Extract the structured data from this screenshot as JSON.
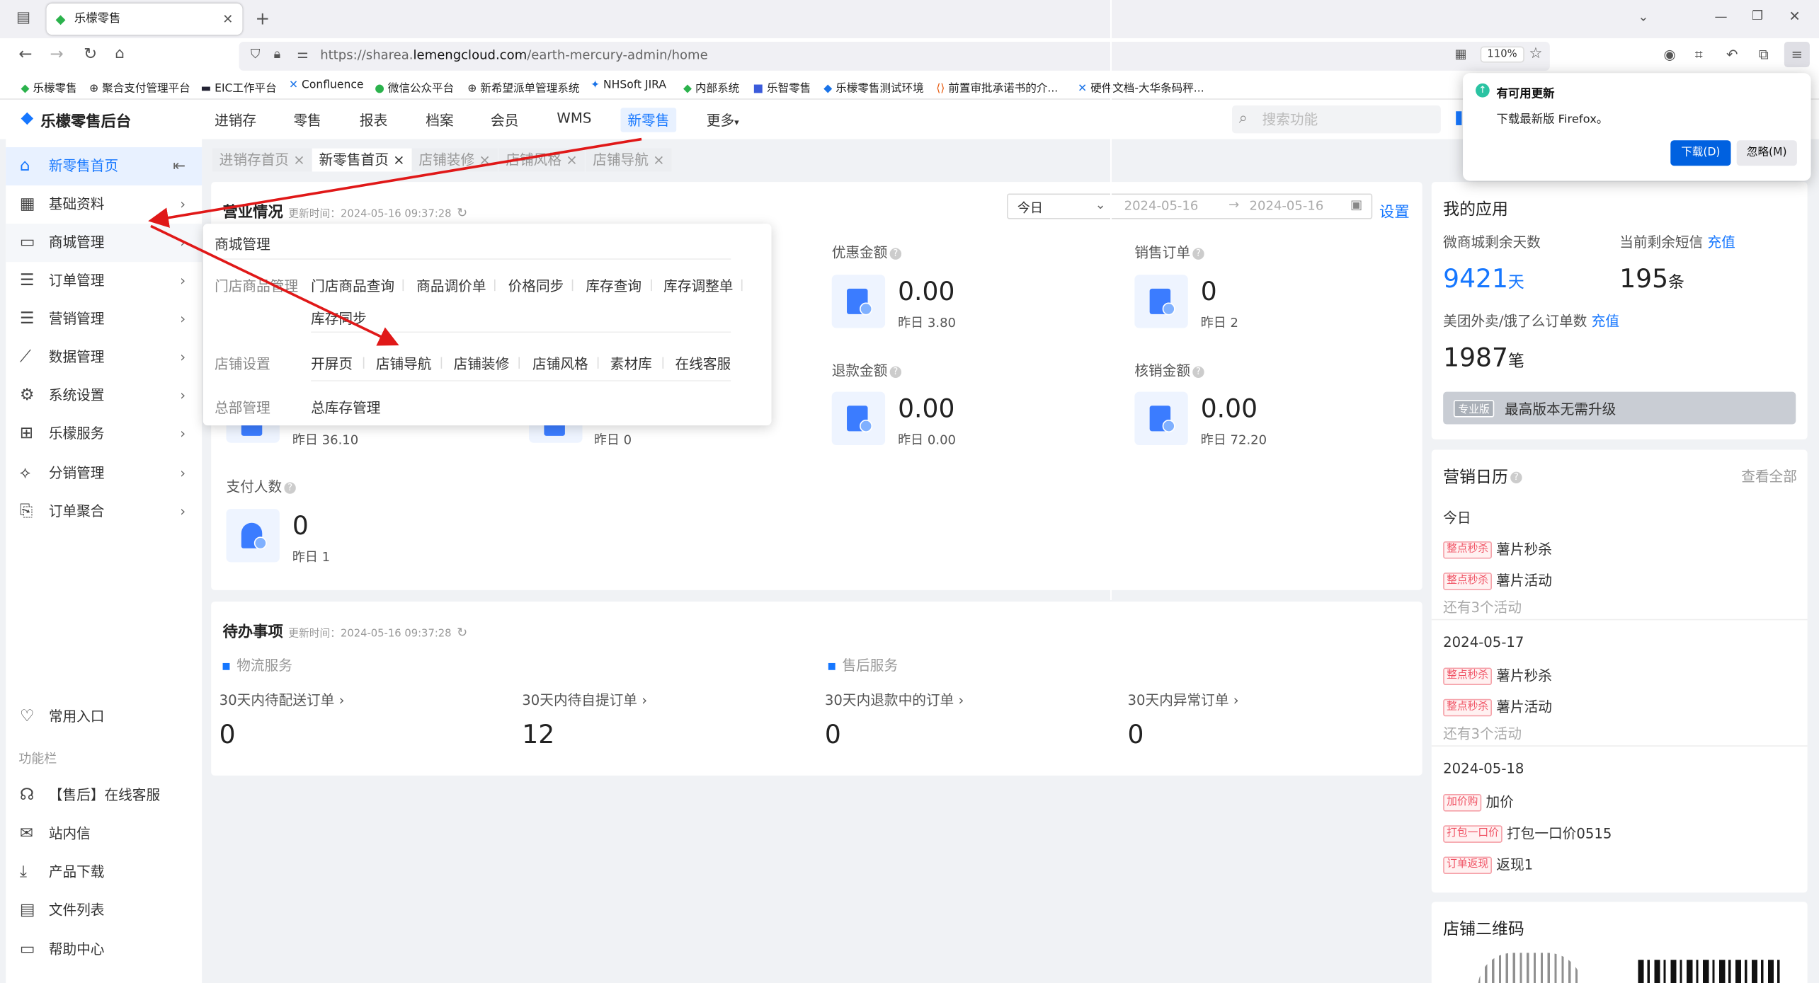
{
  "browser": {
    "tab_title": "乐檬零售",
    "url_prefix": "https://sharea.",
    "url_domain": "lemengcloud.com",
    "url_path": "/earth-mercury-admin/home",
    "zoom": "110%",
    "bookmarks": [
      "乐檬零售",
      "聚合支付管理平台",
      "EIC工作平台",
      "Confluence",
      "微信公众平台",
      "新希望派单管理系统",
      "NHSoft JIRA",
      "内部系统",
      "乐智零售",
      "乐檬零售测试环境",
      "前置审批承诺书的介...",
      "硬件文档-大华条码秤..."
    ]
  },
  "app": {
    "logo": "乐檬零售后台",
    "nav": [
      "进销存",
      "零售",
      "报表",
      "档案",
      "会员",
      "WMS",
      "新零售",
      "更多"
    ],
    "search_placeholder": "搜索功能"
  },
  "sidebar": {
    "items": [
      {
        "label": "新零售首页",
        "icon": "home-icon"
      },
      {
        "label": "基础资料",
        "icon": "grid-icon"
      },
      {
        "label": "商城管理",
        "icon": "shop-icon"
      },
      {
        "label": "订单管理",
        "icon": "list-icon"
      },
      {
        "label": "营销管理",
        "icon": "list-icon"
      },
      {
        "label": "数据管理",
        "icon": "chart-line-icon"
      },
      {
        "label": "系统设置",
        "icon": "gear-icon"
      },
      {
        "label": "乐檬服务",
        "icon": "briefcase-icon"
      },
      {
        "label": "分销管理",
        "icon": "share-icon"
      },
      {
        "label": "订单聚合",
        "icon": "doc-icon"
      }
    ],
    "common_entry": "常用入口",
    "func_bar": "功能栏",
    "func_items": [
      "【售后】在线客服",
      "站内信",
      "产品下载",
      "文件列表",
      "帮助中心"
    ]
  },
  "page_tabs": [
    "进销存首页",
    "新零售首页",
    "店铺装修",
    "店铺风格",
    "店铺导航"
  ],
  "business": {
    "title": "营业情况",
    "update_time": "更新时间：2024-05-16 09:37:28",
    "period": "今日",
    "date_from": "2024-05-16",
    "date_to": "2024-05-16",
    "settings": "设置",
    "metrics": [
      {
        "label": "优惠金额",
        "value": "0.00",
        "yesterday": "昨日 3.80"
      },
      {
        "label": "销售订单",
        "value": "0",
        "yesterday": "昨日 2"
      },
      {
        "label": "退款金额",
        "value": "0.00",
        "yesterday": "昨日 0.00"
      },
      {
        "label": "核销金额",
        "value": "0.00",
        "yesterday": "昨日 72.20"
      },
      {
        "label": "支付人数",
        "value": "0",
        "yesterday": "昨日 1"
      }
    ],
    "hidden_yesterday_1": "昨日 36.10",
    "hidden_yesterday_2": "昨日 0"
  },
  "mall_menu": {
    "title": "商城管理",
    "groups": [
      {
        "name": "门店商品管理",
        "items": [
          "门店商品查询",
          "商品调价单",
          "价格同步",
          "库存查询",
          "库存调整单",
          "库存同步"
        ]
      },
      {
        "name": "店铺设置",
        "items": [
          "开屏页",
          "店铺导航",
          "店铺装修",
          "店铺风格",
          "素材库",
          "在线客服"
        ]
      },
      {
        "name": "总部管理",
        "items": [
          "总库存管理"
        ]
      }
    ]
  },
  "todo": {
    "title": "待办事项",
    "update_time": "更新时间：2024-05-16 09:37:28",
    "sections": [
      "物流服务",
      "售后服务"
    ],
    "items": [
      {
        "label": "30天内待配送订单",
        "value": "0"
      },
      {
        "label": "30天内待自提订单",
        "value": "12"
      },
      {
        "label": "30天内退款中的订单",
        "value": "0"
      },
      {
        "label": "30天内异常订单",
        "value": "0"
      }
    ]
  },
  "my_apps": {
    "title": "我的应用",
    "mall_days_label": "微商城剩余天数",
    "mall_days": "9421",
    "mall_days_unit": "天",
    "sms_label": "当前剩余短信",
    "sms_recharge": "充值",
    "sms": "195",
    "sms_unit": "条",
    "delivery_label": "美团外卖/饿了么订单数",
    "delivery_recharge": "充值",
    "delivery": "1987",
    "delivery_unit": "笔",
    "edition_badge": "专业版",
    "edition_text": "最高版本无需升级"
  },
  "calendar": {
    "title": "营销日历",
    "view_all": "查看全部",
    "days": [
      {
        "date": "今日",
        "events": [
          {
            "tag": "整点秒杀",
            "name": "薯片秒杀"
          },
          {
            "tag": "整点秒杀",
            "name": "薯片活动"
          }
        ],
        "more": "还有3个活动"
      },
      {
        "date": "2024-05-17",
        "events": [
          {
            "tag": "整点秒杀",
            "name": "薯片秒杀"
          },
          {
            "tag": "整点秒杀",
            "name": "薯片活动"
          }
        ],
        "more": "还有3个活动"
      },
      {
        "date": "2024-05-18",
        "events": [
          {
            "tag": "加价购",
            "name": "加价"
          },
          {
            "tag": "打包一口价",
            "name": "打包一口价0515"
          },
          {
            "tag": "订单返现",
            "name": "返现1"
          }
        ],
        "more": ""
      }
    ]
  },
  "qrcode": {
    "title": "店铺二维码"
  },
  "update_popup": {
    "title": "有可用更新",
    "body": "下载最新版 Firefox。",
    "download": "下载(D)",
    "ignore": "忽略(M)"
  }
}
